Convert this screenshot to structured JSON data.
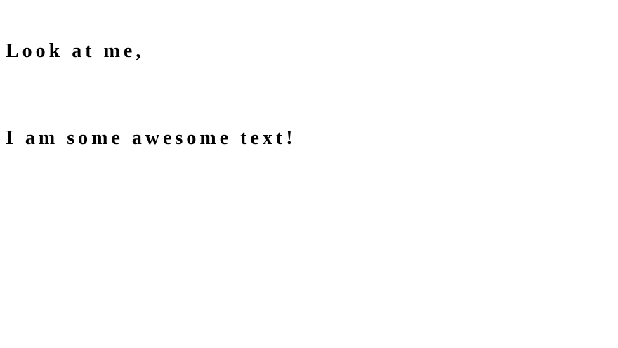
{
  "content": {
    "line1": "Look at me,",
    "line2": "I am some awesome text!"
  },
  "colors": {
    "text": "#000000",
    "background": "#ffffff"
  }
}
